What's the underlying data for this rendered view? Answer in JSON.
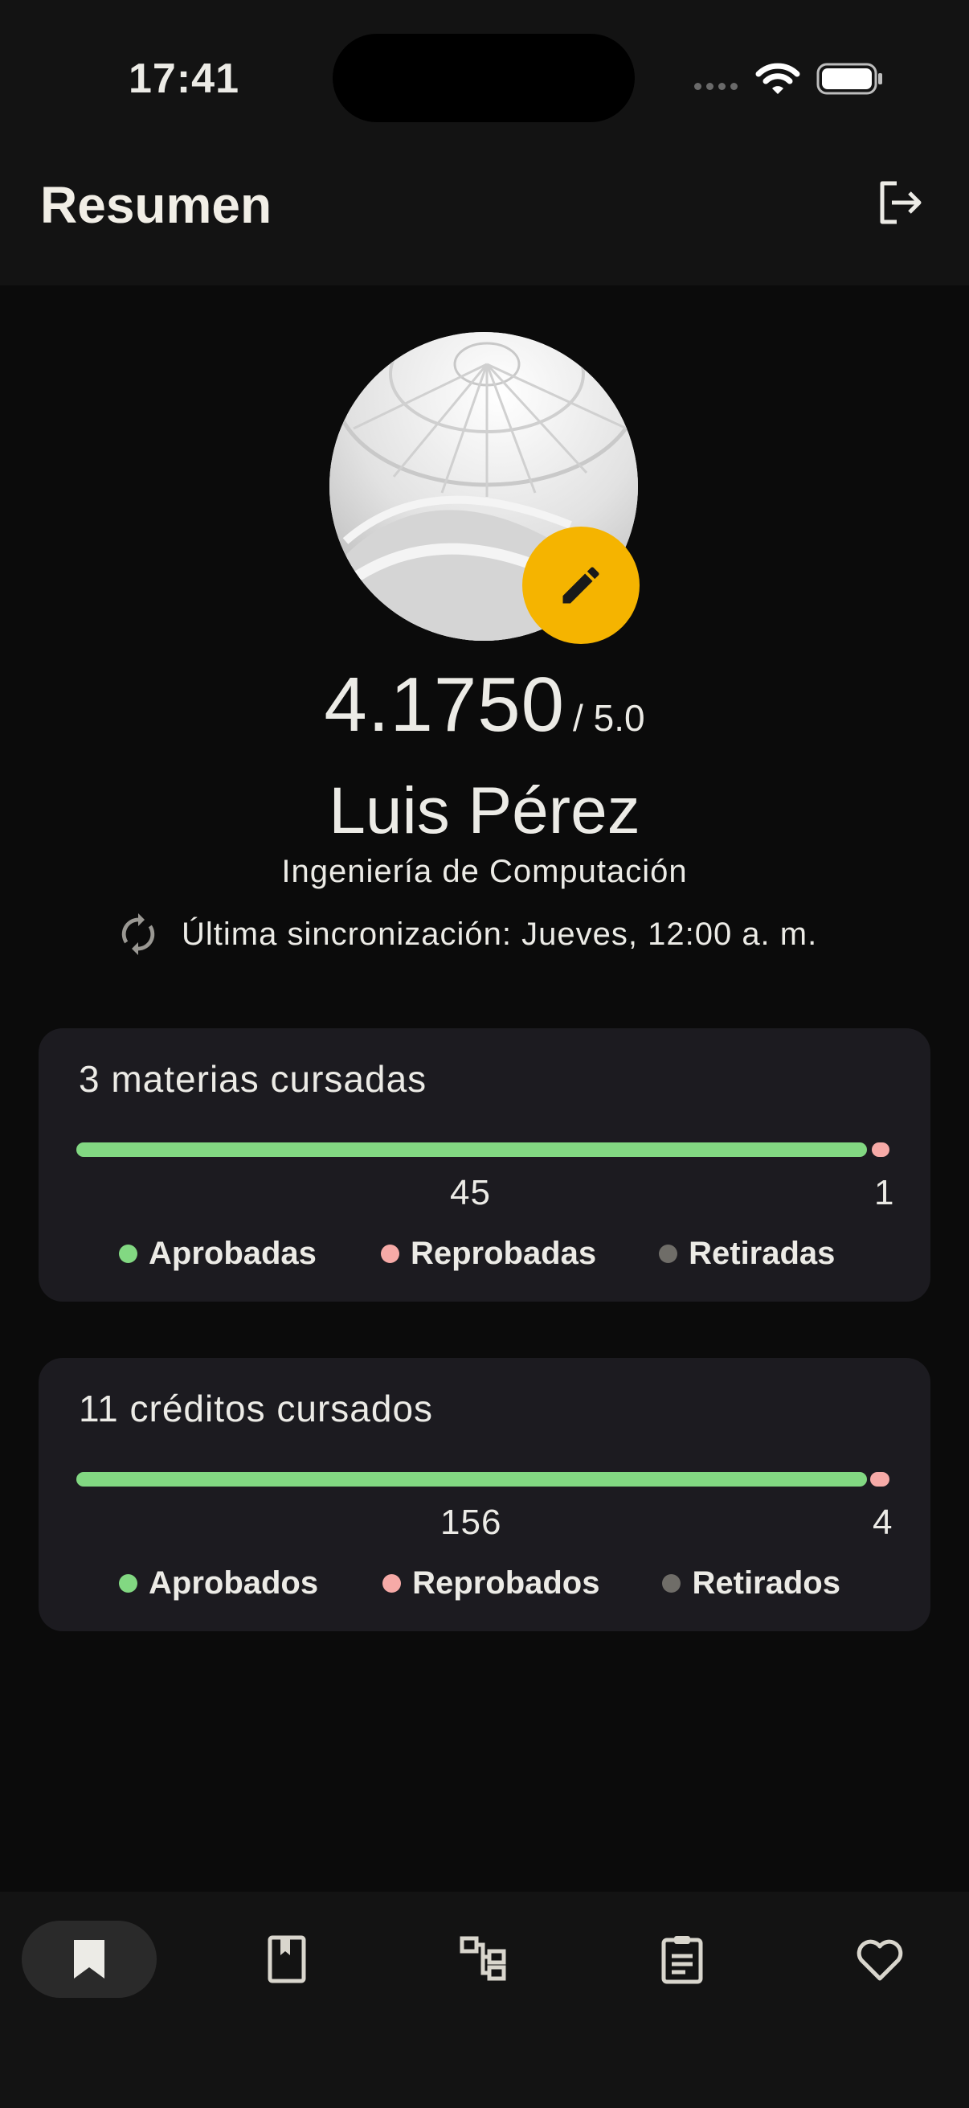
{
  "status_bar": {
    "time": "17:41"
  },
  "header": {
    "title": "Resumen",
    "logout_icon": "logout-icon"
  },
  "profile": {
    "gpa_value": "4.1750",
    "gpa_max": "/ 5.0",
    "name": "Luis Pérez",
    "career": "Ingeniería de Computación",
    "sync_text": "Última sincronización: Jueves, 12:00 a. m."
  },
  "subjects_card": {
    "title": "3 materias cursadas",
    "approved": "45",
    "failed": "1",
    "legend": {
      "approved": "Aprobadas",
      "failed": "Reprobadas",
      "withdrawn": "Retiradas"
    }
  },
  "credits_card": {
    "title": "11 créditos cursados",
    "approved": "156",
    "failed": "4",
    "legend": {
      "approved": "Aprobados",
      "failed": "Reprobados",
      "withdrawn": "Retirados"
    }
  },
  "colors": {
    "approved": "#82d882",
    "failed": "#f6aaa7",
    "withdrawn": "#6f6d68",
    "accent": "#f5b400"
  },
  "bottom_nav": {
    "items": [
      "bookmark-icon",
      "book-icon",
      "tree-icon",
      "clipboard-icon",
      "heart-icon"
    ]
  }
}
